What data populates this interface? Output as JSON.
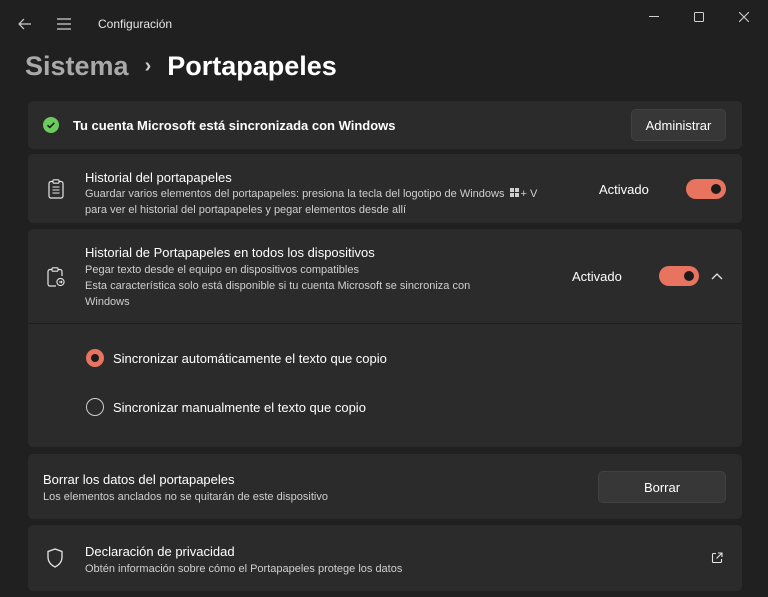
{
  "window": {
    "title": "Configuración"
  },
  "breadcrumb": {
    "parent": "Sistema",
    "separator": "›",
    "current": "Portapapeles"
  },
  "account_banner": {
    "text": "Tu cuenta Microsoft está sincronizada con Windows",
    "button": "Administrar"
  },
  "history": {
    "title": "Historial del portapapeles",
    "desc_line1": "Guardar varios elementos del portapapeles: presiona la tecla del logotipo de Windows",
    "desc_key": "+ V",
    "desc_line2": "para ver el historial del portapapeles y pegar elementos desde allí",
    "state": "Activado"
  },
  "sync": {
    "title": "Historial de Portapapeles en todos los dispositivos",
    "desc_line1": "Pegar texto desde el equipo en dispositivos compatibles",
    "desc_line2": "Esta característica solo está disponible si tu cuenta Microsoft se sincroniza con",
    "desc_line3": "Windows",
    "state": "Activado",
    "options": [
      {
        "label": "Sincronizar automáticamente el texto que copio",
        "selected": true
      },
      {
        "label": "Sincronizar manualmente el texto que copio",
        "selected": false
      }
    ]
  },
  "clear": {
    "title": "Borrar los datos del portapapeles",
    "desc": "Los elementos anclados no se quitarán de este dispositivo",
    "button": "Borrar"
  },
  "privacy": {
    "title": "Declaración de privacidad",
    "desc": "Obtén información sobre cómo el Portapapeles protege los datos"
  },
  "colors": {
    "accent": "#e8735f",
    "success": "#6ccb5f",
    "background": "#202020",
    "card": "#2b2b2b"
  },
  "icons": [
    "back-arrow-icon",
    "hamburger-menu-icon",
    "minimize-icon",
    "maximize-icon",
    "close-icon",
    "check-circle-icon",
    "clipboard-icon",
    "clipboard-sync-icon",
    "chevron-up-icon",
    "shield-icon",
    "external-link-icon",
    "windows-logo-icon"
  ]
}
